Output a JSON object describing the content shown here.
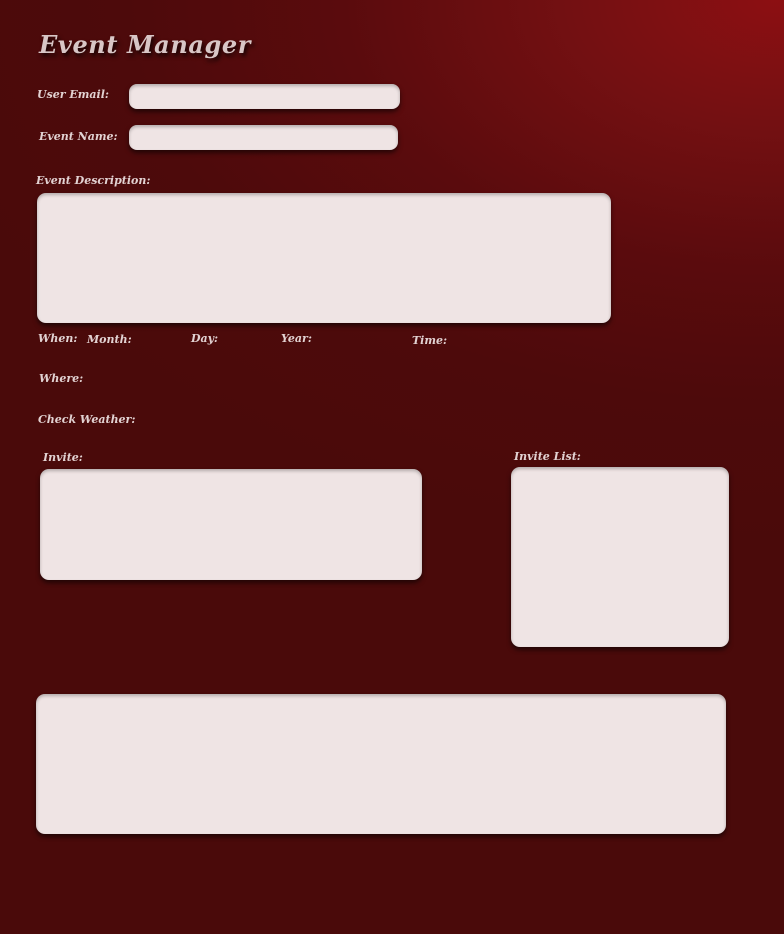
{
  "app": {
    "title": "Event Manager"
  },
  "form": {
    "user_email": {
      "label": "User Email:",
      "value": "",
      "placeholder": ""
    },
    "event_name": {
      "label": "Event Name:",
      "value": "",
      "placeholder": ""
    },
    "event_description": {
      "label": "Event Description:",
      "value": ""
    },
    "when": {
      "label": "When:",
      "month_label": "Month:",
      "day_label": "Day:",
      "year_label": "Year:",
      "time_label": "Time:"
    },
    "where": {
      "label": "Where:"
    },
    "check_weather": {
      "label": "Check Weather:"
    },
    "invite": {
      "label": "Invite:",
      "value": ""
    },
    "invite_list": {
      "label": "Invite List:",
      "value": ""
    },
    "output": {
      "value": ""
    }
  },
  "colors": {
    "background_dark": "#4a0a0a",
    "background_highlight": "#8c0f12",
    "field_fill": "#efe4e4",
    "label_text": "#e2d2d2",
    "title_text": "#d8c6c6"
  }
}
